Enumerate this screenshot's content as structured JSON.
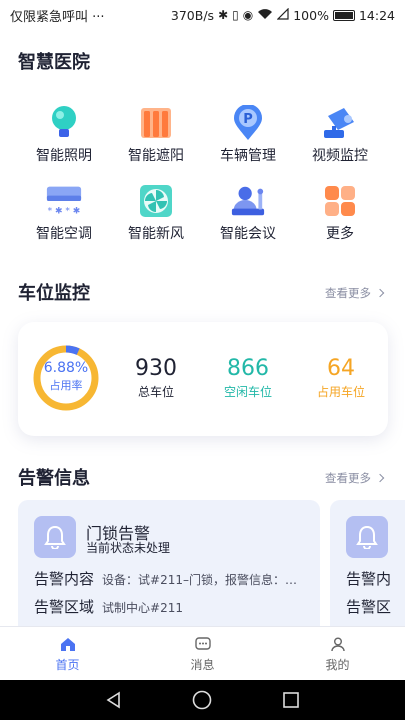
{
  "status_bar": {
    "left_text": "仅限紧急呼叫 ···",
    "speed": "370B/s",
    "battery": "100%",
    "time": "14:24"
  },
  "page_title": "智慧医院",
  "grid": [
    {
      "label": "智能照明",
      "icon": "bulb-icon"
    },
    {
      "label": "智能遮阳",
      "icon": "sunshade-icon"
    },
    {
      "label": "车辆管理",
      "icon": "parking-icon"
    },
    {
      "label": "视频监控",
      "icon": "camera-icon"
    },
    {
      "label": "智能空调",
      "icon": "aircon-icon"
    },
    {
      "label": "智能新风",
      "icon": "fan-icon"
    },
    {
      "label": "智能会议",
      "icon": "meeting-icon"
    },
    {
      "label": "更多",
      "icon": "more-grid-icon"
    }
  ],
  "parking": {
    "title": "车位监控",
    "more": "查看更多",
    "occupancy_rate": "6.88%",
    "occupancy_fraction": 0.0688,
    "occupancy_label": "占用率",
    "total": "930",
    "total_label": "总车位",
    "free": "866",
    "free_label": "空闲车位",
    "used": "64",
    "used_label": "占用车位"
  },
  "alarm": {
    "title": "告警信息",
    "more": "查看更多",
    "cards": [
      {
        "name": "门锁告警",
        "status": "当前状态未处理",
        "content_key": "告警内容",
        "content_val": "设备：试#211–门锁，报警信息：…",
        "area_key": "告警区域",
        "area_val": "试制中心#211"
      },
      {
        "content_key": "告警内",
        "area_key": "告警区"
      }
    ]
  },
  "tabs": [
    {
      "label": "首页",
      "icon": "home-icon",
      "active": true
    },
    {
      "label": "消息",
      "icon": "message-icon",
      "active": false
    },
    {
      "label": "我的",
      "icon": "profile-icon",
      "active": false
    }
  ],
  "colors": {
    "accent": "#4b73f2",
    "free": "#22b8a8",
    "used": "#f5a524",
    "gauge_track": "#f7b733"
  }
}
